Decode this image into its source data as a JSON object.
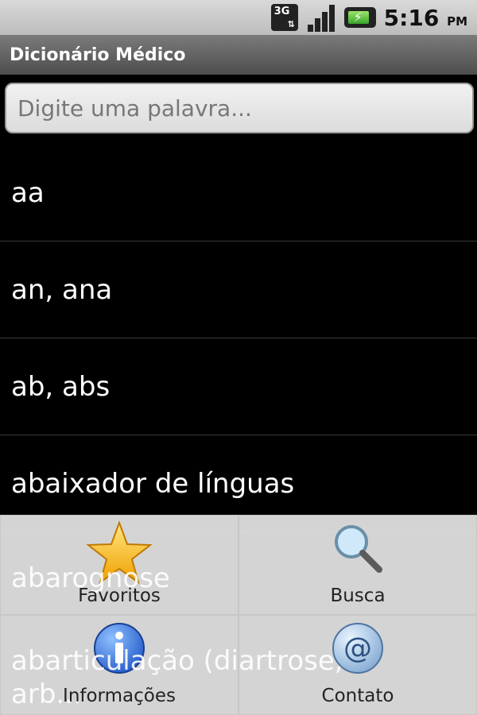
{
  "status": {
    "network": "3G",
    "time": "5:16",
    "ampm": "PM"
  },
  "app": {
    "title": "Dicionário Médico"
  },
  "search": {
    "placeholder": "Digite uma palavra..."
  },
  "words": [
    "aa",
    "an, ana",
    "ab, abs",
    "abaixador de línguas"
  ],
  "behind_menu": [
    "abarognose",
    "abarticulação (diartrose,",
    "arb..."
  ],
  "menu": {
    "favoritos": "Favoritos",
    "busca": "Busca",
    "informacoes": "Informações",
    "contato": "Contato"
  }
}
